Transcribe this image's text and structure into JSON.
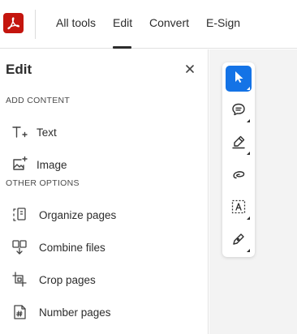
{
  "colors": {
    "brand": "#c4150e",
    "accent": "#1473e6"
  },
  "header": {
    "logo_icon": "acrobat-logo-icon",
    "tabs": [
      {
        "label": "All tools",
        "active": false
      },
      {
        "label": "Edit",
        "active": true
      },
      {
        "label": "Convert",
        "active": false
      },
      {
        "label": "E-Sign",
        "active": false
      }
    ]
  },
  "panel": {
    "title": "Edit",
    "close_icon": "close-icon",
    "sections": [
      {
        "heading": "ADD CONTENT",
        "items": [
          {
            "label": "Text",
            "icon": "add-text-icon"
          },
          {
            "label": "Image",
            "icon": "add-image-icon"
          }
        ]
      },
      {
        "heading": "OTHER OPTIONS",
        "items": [
          {
            "label": "Organize pages",
            "icon": "organize-pages-icon"
          },
          {
            "label": "Combine files",
            "icon": "combine-files-icon"
          },
          {
            "label": "Crop pages",
            "icon": "crop-pages-icon"
          },
          {
            "label": "Number pages",
            "icon": "number-pages-icon"
          }
        ]
      }
    ]
  },
  "quick_tools": [
    {
      "icon": "select-cursor-icon",
      "active": true
    },
    {
      "icon": "comment-icon",
      "active": false
    },
    {
      "icon": "highlight-pen-icon",
      "active": false
    },
    {
      "icon": "draw-freehand-icon",
      "active": false
    },
    {
      "icon": "text-select-icon",
      "active": false
    },
    {
      "icon": "signature-icon",
      "active": false
    }
  ]
}
